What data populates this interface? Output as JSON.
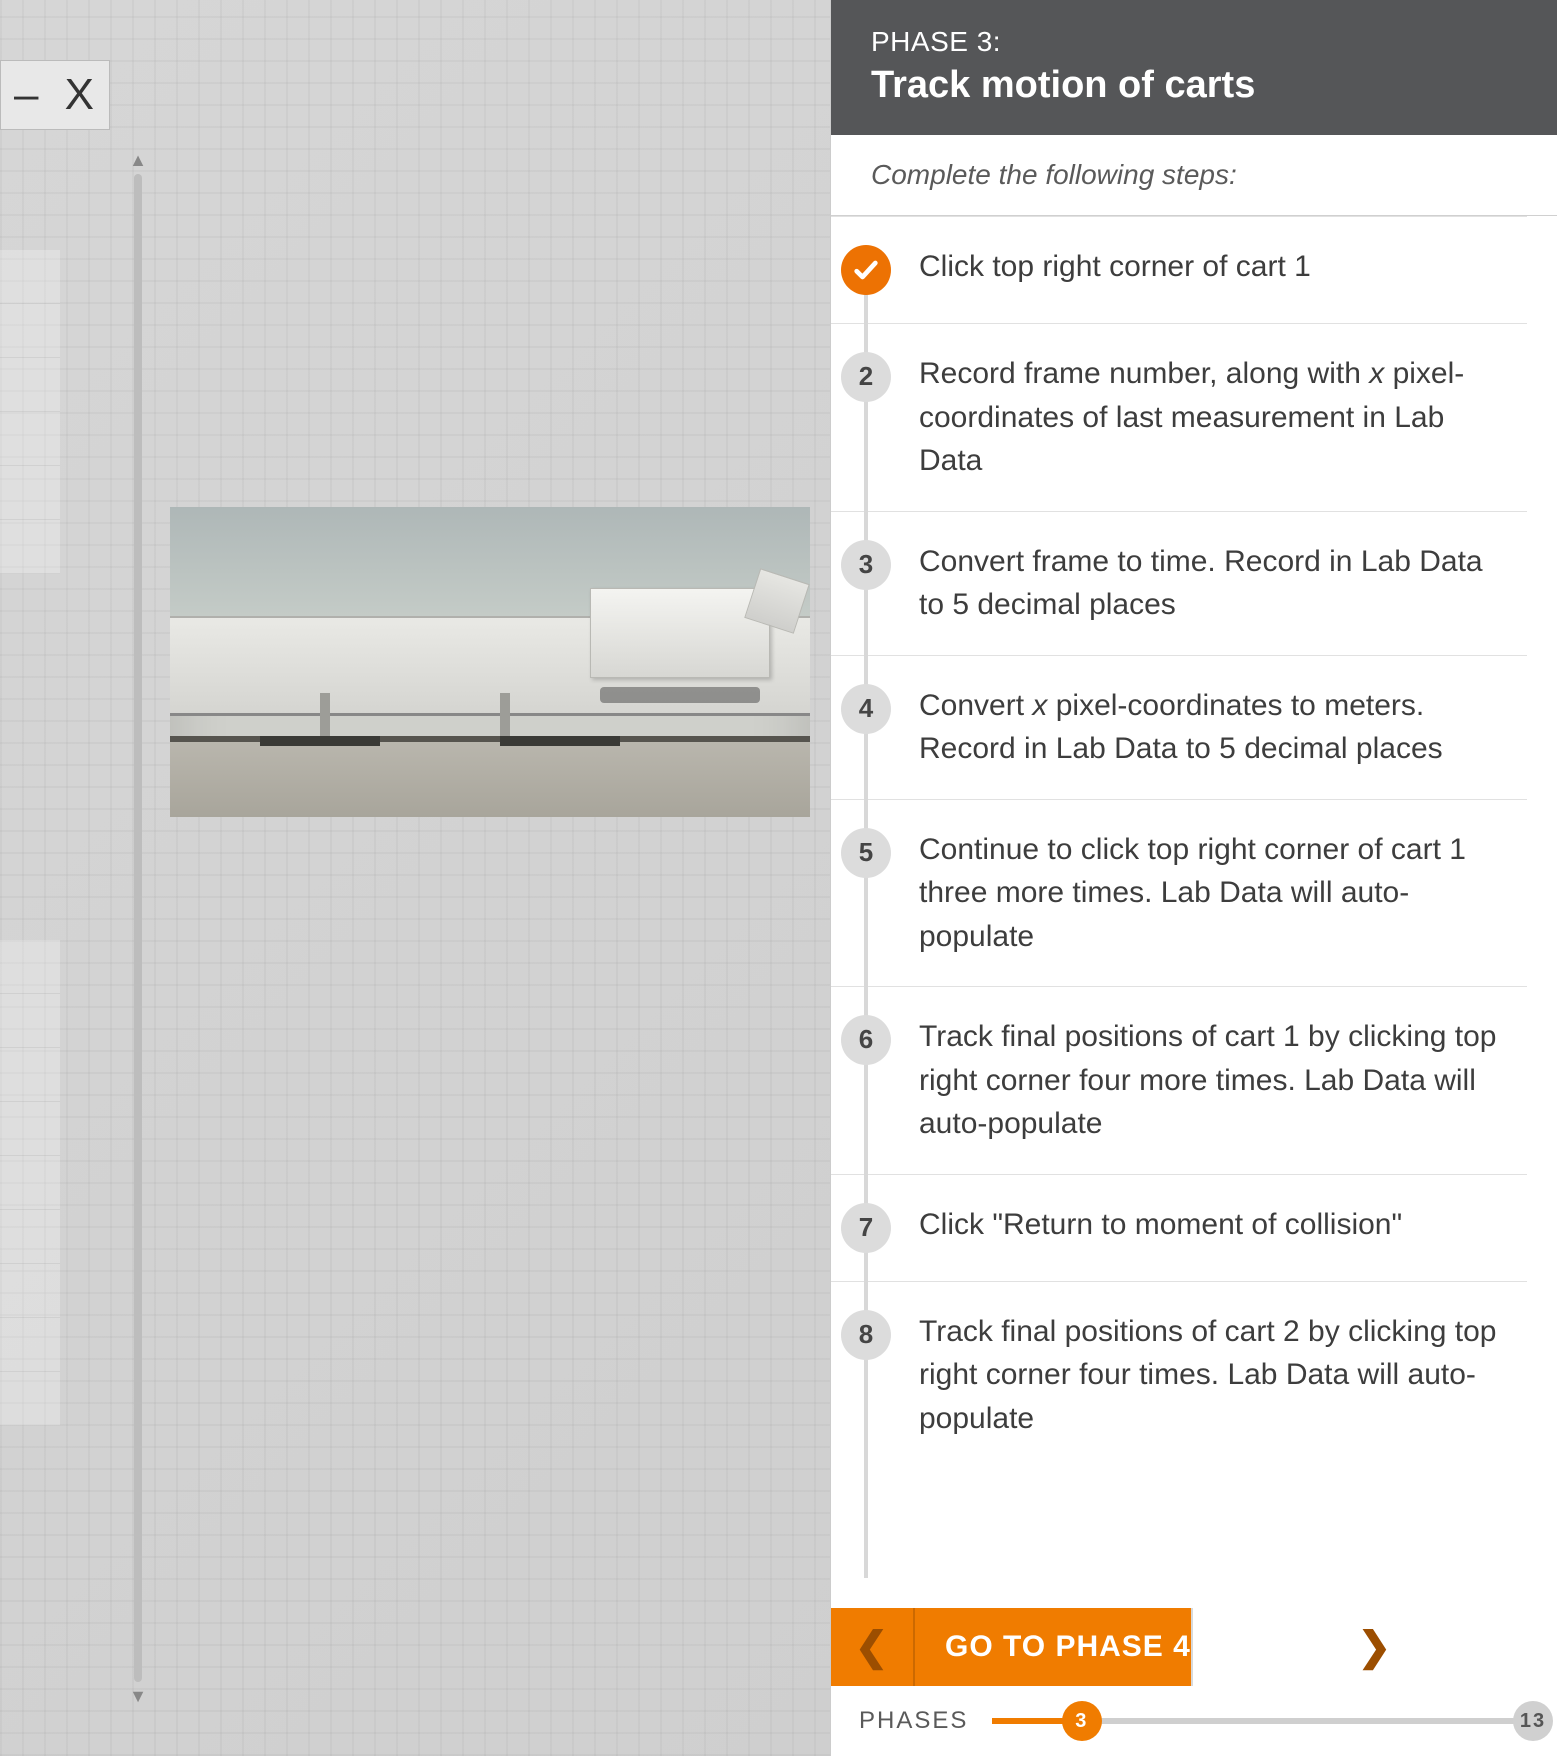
{
  "toolbar": {
    "dash": "–",
    "close": "X"
  },
  "phase": {
    "kicker": "PHASE 3:",
    "title": "Track motion of carts",
    "subhead": "Complete the following steps:"
  },
  "steps": [
    {
      "n": "1",
      "done": true,
      "text_html": "Click top right corner of cart 1"
    },
    {
      "n": "2",
      "done": false,
      "text_html": "Record frame number, along with <em>x</em> pixel-coordinates of last measurement in Lab Data"
    },
    {
      "n": "3",
      "done": false,
      "text_html": "Convert frame to time. Record in Lab Data to 5 decimal places"
    },
    {
      "n": "4",
      "done": false,
      "text_html": "Convert <em>x</em> pixel-coordinates to meters. Record in Lab Data to 5 decimal places"
    },
    {
      "n": "5",
      "done": false,
      "text_html": "Continue to click top right corner of cart 1 three more times. Lab Data will auto-populate"
    },
    {
      "n": "6",
      "done": false,
      "text_html": "Track final positions of cart 1 by clicking top right corner four more times. Lab Data will auto-populate"
    },
    {
      "n": "7",
      "done": false,
      "text_html": "Click \"Return to moment of collision\""
    },
    {
      "n": "8",
      "done": false,
      "text_html": "Track final positions of cart 2 by clicking top right corner four times. Lab Data will auto-populate"
    }
  ],
  "footer": {
    "go_label": "GO TO PHASE 4",
    "slider_label": "PHASES",
    "current_phase": 3,
    "total_phases": 13
  }
}
